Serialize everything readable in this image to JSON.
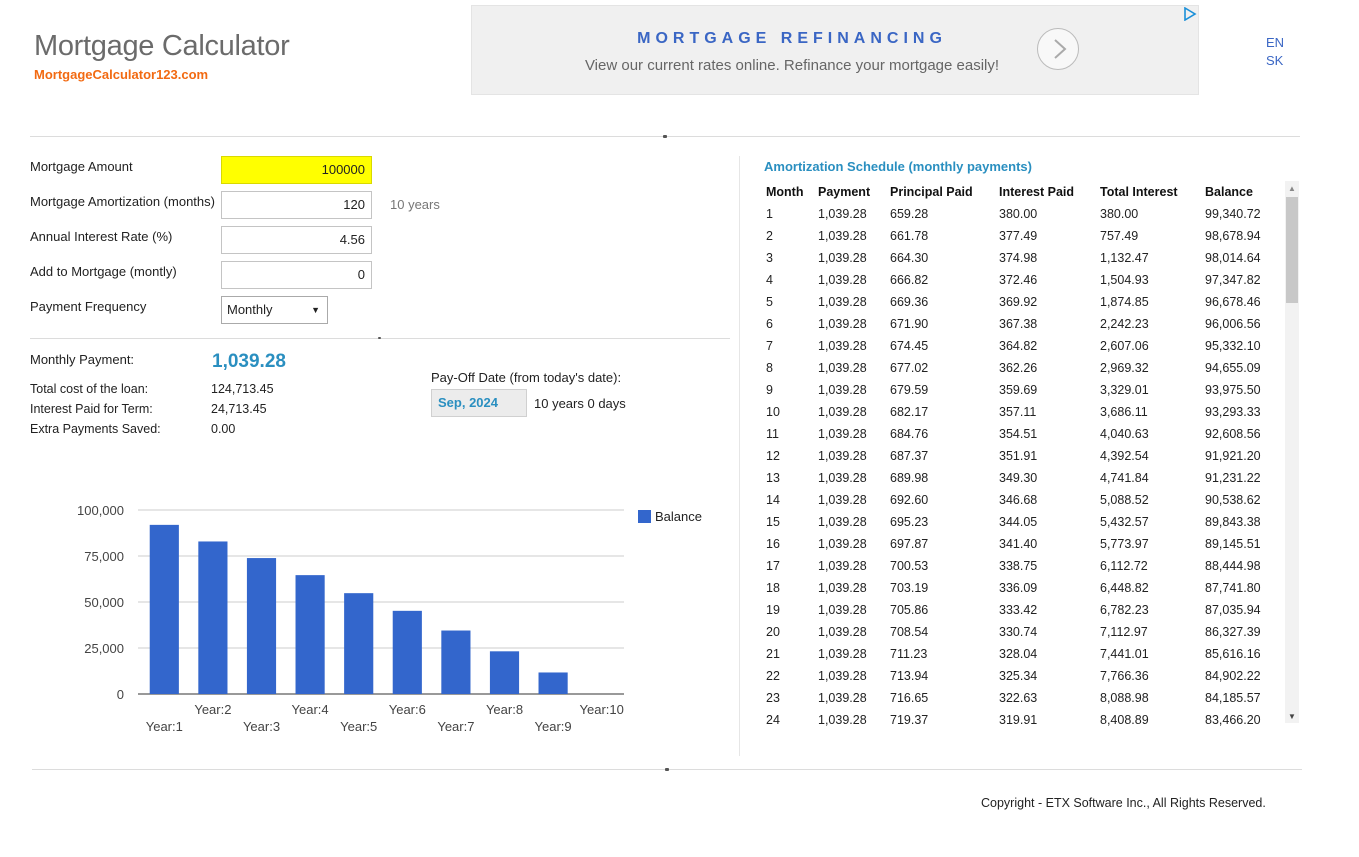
{
  "header": {
    "title": "Mortgage Calculator",
    "site": "MortgageCalculator123.com"
  },
  "ad": {
    "headline": "MORTGAGE REFINANCING",
    "text": "View our current rates online. Refinance your mortgage easily!"
  },
  "languages": [
    "EN",
    "SK"
  ],
  "form": {
    "amount_label": "Mortgage Amount",
    "amount_value": "100000",
    "amortization_label": "Mortgage Amortization (months)",
    "amortization_value": "120",
    "amortization_note": "10 years",
    "rate_label": "Annual Interest Rate (%)",
    "rate_value": "4.56",
    "add_label": "Add to Mortgage (montly)",
    "add_value": "0",
    "frequency_label": "Payment Frequency",
    "frequency_value": "Monthly"
  },
  "results": {
    "monthly_label": "Monthly Payment:",
    "monthly_value": "1,039.28",
    "total_cost_label": "Total cost of the loan:",
    "total_cost_value": "124,713.45",
    "interest_label": "Interest Paid for Term:",
    "interest_value": "24,713.45",
    "extra_label": "Extra Payments Saved:",
    "extra_value": "0.00",
    "payoff_label": "Pay-Off Date (from today's date):",
    "payoff_date": "Sep, 2024",
    "payoff_duration": "10 years 0 days"
  },
  "chart_data": {
    "type": "bar",
    "categories": [
      "Year:1",
      "Year:2",
      "Year:3",
      "Year:4",
      "Year:5",
      "Year:6",
      "Year:7",
      "Year:8",
      "Year:9",
      "Year:10"
    ],
    "series": [
      {
        "name": "Balance",
        "values": [
          91921,
          82900,
          73880,
          64600,
          54800,
          45200,
          34500,
          23200,
          11700,
          0
        ]
      }
    ],
    "yticks": [
      "100,000",
      "75,000",
      "50,000",
      "25,000",
      "0"
    ],
    "ylim": [
      0,
      100000
    ],
    "legend": "right",
    "grid": true,
    "color": "#3366cc"
  },
  "amortization": {
    "title": "Amortization Schedule (monthly payments)",
    "columns": [
      "Month",
      "Payment",
      "Principal Paid",
      "Interest Paid",
      "Total Interest",
      "Balance"
    ],
    "rows": [
      [
        "1",
        "1,039.28",
        "659.28",
        "380.00",
        "380.00",
        "99,340.72"
      ],
      [
        "2",
        "1,039.28",
        "661.78",
        "377.49",
        "757.49",
        "98,678.94"
      ],
      [
        "3",
        "1,039.28",
        "664.30",
        "374.98",
        "1,132.47",
        "98,014.64"
      ],
      [
        "4",
        "1,039.28",
        "666.82",
        "372.46",
        "1,504.93",
        "97,347.82"
      ],
      [
        "5",
        "1,039.28",
        "669.36",
        "369.92",
        "1,874.85",
        "96,678.46"
      ],
      [
        "6",
        "1,039.28",
        "671.90",
        "367.38",
        "2,242.23",
        "96,006.56"
      ],
      [
        "7",
        "1,039.28",
        "674.45",
        "364.82",
        "2,607.06",
        "95,332.10"
      ],
      [
        "8",
        "1,039.28",
        "677.02",
        "362.26",
        "2,969.32",
        "94,655.09"
      ],
      [
        "9",
        "1,039.28",
        "679.59",
        "359.69",
        "3,329.01",
        "93,975.50"
      ],
      [
        "10",
        "1,039.28",
        "682.17",
        "357.11",
        "3,686.11",
        "93,293.33"
      ],
      [
        "11",
        "1,039.28",
        "684.76",
        "354.51",
        "4,040.63",
        "92,608.56"
      ],
      [
        "12",
        "1,039.28",
        "687.37",
        "351.91",
        "4,392.54",
        "91,921.20"
      ],
      [
        "13",
        "1,039.28",
        "689.98",
        "349.30",
        "4,741.84",
        "91,231.22"
      ],
      [
        "14",
        "1,039.28",
        "692.60",
        "346.68",
        "5,088.52",
        "90,538.62"
      ],
      [
        "15",
        "1,039.28",
        "695.23",
        "344.05",
        "5,432.57",
        "89,843.38"
      ],
      [
        "16",
        "1,039.28",
        "697.87",
        "341.40",
        "5,773.97",
        "89,145.51"
      ],
      [
        "17",
        "1,039.28",
        "700.53",
        "338.75",
        "6,112.72",
        "88,444.98"
      ],
      [
        "18",
        "1,039.28",
        "703.19",
        "336.09",
        "6,448.82",
        "87,741.80"
      ],
      [
        "19",
        "1,039.28",
        "705.86",
        "333.42",
        "6,782.23",
        "87,035.94"
      ],
      [
        "20",
        "1,039.28",
        "708.54",
        "330.74",
        "7,112.97",
        "86,327.39"
      ],
      [
        "21",
        "1,039.28",
        "711.23",
        "328.04",
        "7,441.01",
        "85,616.16"
      ],
      [
        "22",
        "1,039.28",
        "713.94",
        "325.34",
        "7,766.36",
        "84,902.22"
      ],
      [
        "23",
        "1,039.28",
        "716.65",
        "322.63",
        "8,088.98",
        "84,185.57"
      ],
      [
        "24",
        "1,039.28",
        "719.37",
        "319.91",
        "8,408.89",
        "83,466.20"
      ]
    ]
  },
  "footer": {
    "copyright": "Copyright - ETX Software Inc., All Rights Reserved."
  }
}
